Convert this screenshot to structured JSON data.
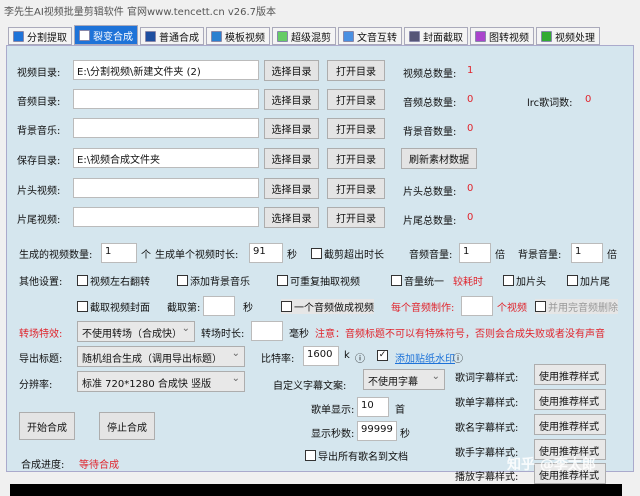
{
  "title": "李先生AI视频批量剪辑软件   官网www.tencett.cn   v26.7版本",
  "tabs": [
    {
      "label": "分割提取",
      "icon": "split-icon"
    },
    {
      "label": "裂变合成",
      "icon": "fission-icon",
      "active": true
    },
    {
      "label": "普通合成",
      "icon": "play-icon"
    },
    {
      "label": "模板视频",
      "icon": "template-icon"
    },
    {
      "label": "超级混剪",
      "icon": "waveform-icon"
    },
    {
      "label": "文音互转",
      "icon": "microphone-icon"
    },
    {
      "label": "封面截取",
      "icon": "image-icon"
    },
    {
      "label": "图转视频",
      "icon": "slideshow-icon"
    },
    {
      "label": "视频处理",
      "icon": "process-icon"
    }
  ],
  "dirs": [
    {
      "label": "视频目录:",
      "value": "E:\\分割视频\\新建文件夹 (2)",
      "stat_label": "视频总数量:",
      "stat": "1"
    },
    {
      "label": "音频目录:",
      "value": "",
      "stat_label": "音频总数量:",
      "stat": "0",
      "extra_label": "lrc歌词数:",
      "extra": "0"
    },
    {
      "label": "背景音乐:",
      "value": "",
      "stat_label": "背景音数量:",
      "stat": "0"
    },
    {
      "label": "保存目录:",
      "value": "E:\\视频合成文件夹",
      "refresh": "刷新素材数据"
    },
    {
      "label": "片头视频:",
      "value": "",
      "stat_label": "片头总数量:",
      "stat": "0"
    },
    {
      "label": "片尾视频:",
      "value": "",
      "stat_label": "片尾总数量:",
      "stat": "0"
    }
  ],
  "choose_dir": "选择目录",
  "open_dir": "打开目录",
  "gen": {
    "count_label": "生成的视频数量:",
    "count": "1",
    "count_unit": "个",
    "dur_label": "生成单个视频时长:",
    "dur": "91",
    "dur_unit": "秒",
    "cut_over": "截剪超出时长",
    "audio_vol_label": "音频音量:",
    "audio_vol": "1",
    "bg_vol_label": "背景音量:",
    "bg_vol": "1",
    "times": "倍"
  },
  "other": {
    "label": "其他设置:",
    "flip": "视频左右翻转",
    "add_bg": "添加背景音乐",
    "repeat": "可重复抽取视频",
    "vol_unify": "音量统一",
    "slow": "较耗时",
    "add_head": "加片头",
    "add_tail": "加片尾",
    "cover": "截取视频封面",
    "cut_at_label": "截取第:",
    "sec": "秒",
    "one_audio": "一个音频做成视频",
    "per_audio_label": "每个音频制作:",
    "per_audio_unit": "个视频",
    "delete_used": "并用完音频删除"
  },
  "transition": {
    "label": "转场特效:",
    "value": "不使用转场（合成快）",
    "dur_label": "转场时长:",
    "ms": "毫秒",
    "warning": "注意：音频标题不可以有特殊符号，否则会合成失败或者没有声音"
  },
  "export_title": {
    "label": "导出标题:",
    "value": "随机组合生成（调用导出标题）"
  },
  "resolution": {
    "label": "分辨率:",
    "value": "标准 720*1280 合成快 竖版"
  },
  "bitrate": {
    "label": "比特率:",
    "value": "1600",
    "unit": "k",
    "watermark": "添加贴纸水印",
    "watermark_checked": true
  },
  "subtitle": {
    "label": "自定义字幕文案:",
    "value": "不使用字幕"
  },
  "playlist": {
    "label": "歌单显示:",
    "value": "10",
    "unit": "首"
  },
  "show_secs": {
    "label": "显示秒数:",
    "value": "99999",
    "unit": "秒"
  },
  "export_names": "导出所有歌名到文档",
  "styles": [
    {
      "label": "歌词字幕样式:",
      "value": "使用推荐样式"
    },
    {
      "label": "歌单字幕样式:",
      "value": "使用推荐样式"
    },
    {
      "label": "歌名字幕样式:",
      "value": "使用推荐样式"
    },
    {
      "label": "歌手字幕样式:",
      "value": "使用推荐样式"
    },
    {
      "label": "播放字幕样式:",
      "value": "使用推荐样式"
    }
  ],
  "start": "开始合成",
  "stop": "停止合成",
  "progress": {
    "label": "合成进度:",
    "value": "等待合成"
  },
  "watermark_text": "知乎 @李太郎",
  "colors": {
    "accent": "#1e73d8",
    "panel": "#d5e6ee",
    "warning": "#e0242c"
  }
}
